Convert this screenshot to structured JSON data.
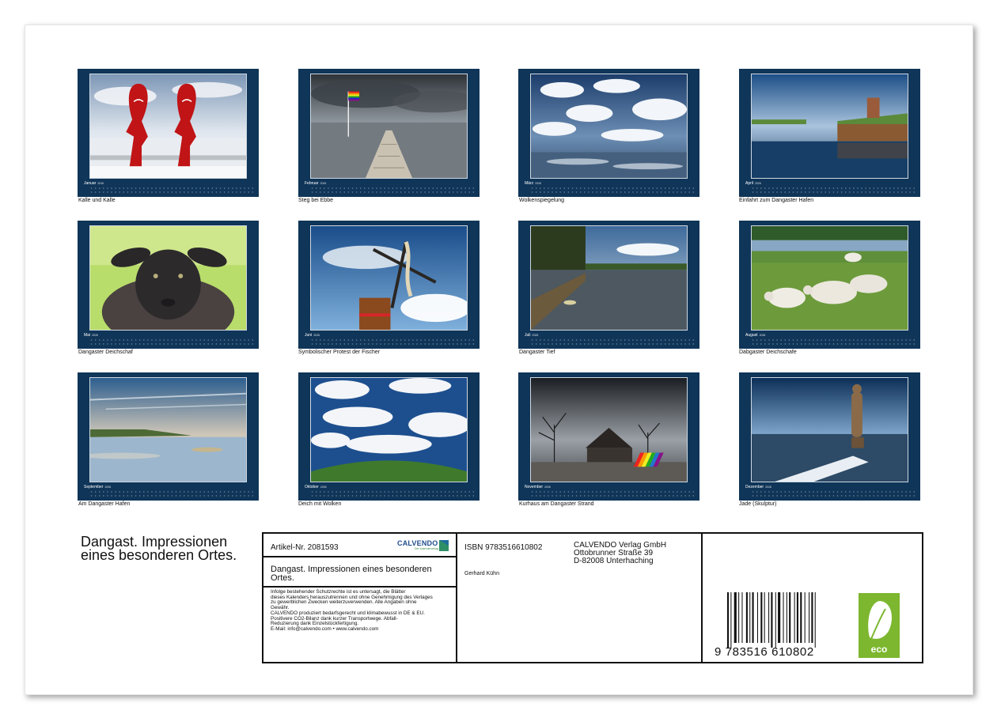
{
  "months": [
    {
      "month": "Januar",
      "year": "2026",
      "caption": "Kalle und Kalle"
    },
    {
      "month": "Februar",
      "year": "2026",
      "caption": "Steg bei Ebbe"
    },
    {
      "month": "März",
      "year": "2026",
      "caption": "Wolkenspiegelung"
    },
    {
      "month": "April",
      "year": "2026",
      "caption": "Einfahrt zum Dangaster Hafen"
    },
    {
      "month": "Mai",
      "year": "2026",
      "caption": "Dangaster Deichschaf"
    },
    {
      "month": "Juni",
      "year": "2026",
      "caption": "Symbolischer Protest der Fischer"
    },
    {
      "month": "Juli",
      "year": "2026",
      "caption": "Dangaster Tief"
    },
    {
      "month": "August",
      "year": "2026",
      "caption": "Dabgaster Deichschafe"
    },
    {
      "month": "September",
      "year": "2026",
      "caption": "Am Dangaster Hafen"
    },
    {
      "month": "Oktober",
      "year": "2026",
      "caption": "Deich mit Wolken"
    },
    {
      "month": "November",
      "year": "2026",
      "caption": "Kurhaus am Dangaster Strand"
    },
    {
      "month": "Dezember",
      "year": "2026",
      "caption": "Jade (Skulptur)"
    }
  ],
  "cover": {
    "title": "Dangast. Impressionen eines besonderen Ortes."
  },
  "info": {
    "artikel": "Artikel-Nr. 2081593",
    "logo_text": "CALVENDO",
    "logo_sub": "Der Kalenderverlag",
    "book_title": "Dangast. Impressionen eines besonderen Ortes.",
    "legal": "Infolge bestehender Schutzrechte ist es untersagt, die Blätter\ndieses Kalenders herauszutrennen und ohne Genehmigung des Verlages\nzu gewerblichen Zwecken weiterzuverwenden. Alle Angaben ohne\nGewähr.\nCALVENDO produziert bedarfsgerecht und klimabewusst in DE & EU.\nPositivere CO2-Bilanz dank kurzer Transportwege. Abfall-\nReduzierung dank Einzelstückfertigung.\nE-Mail: info@calvendo.com • www.calvendo.com",
    "isbn": "ISBN 9783516610802",
    "author": "Gerhard Kühn",
    "publisher": "CALVENDO Verlag GmbH\nOttobrunner Straße 39\nD-82008 Unterhaching",
    "barcode_digits": "9 783516 610802",
    "eco_label": "eco"
  },
  "colors": {
    "card_bg": "#0f3558",
    "eco_green": "#7cb72f",
    "brand_blue": "#1f4d8c"
  }
}
